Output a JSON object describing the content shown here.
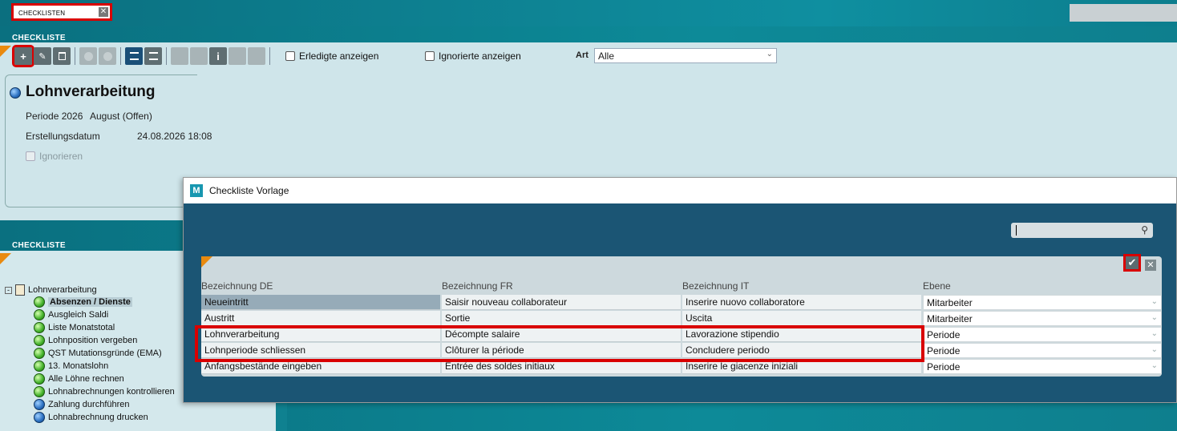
{
  "top": {
    "tab_label": "CHECKLISTEN",
    "tab_close": "✕"
  },
  "upper": {
    "section_label": "CHECKLISTE",
    "toolbar": {
      "add": "+",
      "edit": "✎",
      "delete": "🗑",
      "info": "i"
    },
    "show_done_label": "Erledigte anzeigen",
    "show_ignored_label": "Ignorierte anzeigen",
    "art_label": "Art",
    "art_value": "Alle",
    "title": "Lohnverarbeitung",
    "periode_label": "Periode 2026",
    "periode_value": "August (Offen)",
    "date_label": "Erstellungsdatum",
    "date_value": "24.08.2026 18:08",
    "ignore_label": "Ignorieren"
  },
  "lower": {
    "section_label": "CHECKLISTE",
    "tree_root": "Lohnverarbeitung",
    "items": [
      {
        "label": "Absenzen / Dienste",
        "status": "green"
      },
      {
        "label": "Ausgleich Saldi",
        "status": "green"
      },
      {
        "label": "Liste Monatstotal",
        "status": "green"
      },
      {
        "label": "Lohnposition vergeben",
        "status": "green"
      },
      {
        "label": "QST Mutationsgründe (EMA)",
        "status": "green"
      },
      {
        "label": "13. Monatslohn",
        "status": "green"
      },
      {
        "label": "Alle Löhne rechnen",
        "status": "green"
      },
      {
        "label": "Lohnabrechnungen kontrollieren",
        "status": "green"
      },
      {
        "label": "Zahlung durchführen",
        "status": "blue"
      },
      {
        "label": "Lohnabrechnung drucken",
        "status": "blue"
      }
    ]
  },
  "dialog": {
    "title": "Checkliste Vorlage",
    "logo": "M",
    "headers": [
      "Bezeichnung DE",
      "Bezeichnung FR",
      "Bezeichnung IT",
      "Ebene"
    ],
    "rows": [
      [
        "Neueintritt",
        "Saisir nouveau collaborateur",
        "Inserire nuovo collaboratore",
        "Mitarbeiter"
      ],
      [
        "Austritt",
        "Sortie",
        "Uscita",
        "Mitarbeiter"
      ],
      [
        "Lohnverarbeitung",
        "Décompte salaire",
        "Lavorazione stipendio",
        "Periode"
      ],
      [
        "Lohnperiode schliessen",
        "Clôturer la période",
        "Concludere periodo",
        "Periode"
      ],
      [
        "Anfangsbestände eingeben",
        "Entrée des soldes initiaux",
        "Inserire le giacenze iniziali",
        "Periode"
      ]
    ],
    "ok_icon": "✔",
    "close_icon": "✕"
  }
}
